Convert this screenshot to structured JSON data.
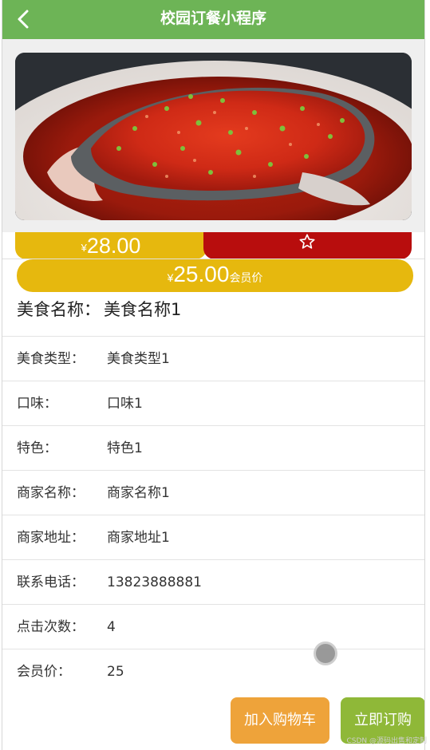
{
  "header": {
    "title": "校园订餐小程序"
  },
  "price": {
    "currency": "¥",
    "value": "28.00"
  },
  "vip": {
    "currency": "¥",
    "value": "25.00",
    "tag": "会员价"
  },
  "food": {
    "name_label": "美食名称：",
    "name_value": "美食名称1"
  },
  "details": [
    {
      "label": "美食类型：",
      "value": "美食类型1"
    },
    {
      "label": "口味：",
      "value": "口味1"
    },
    {
      "label": "特色：",
      "value": "特色1"
    },
    {
      "label": "商家名称：",
      "value": "商家名称1"
    },
    {
      "label": "商家地址：",
      "value": "商家地址1"
    },
    {
      "label": "联系电话：",
      "value": "13823888881"
    },
    {
      "label": "点击次数：",
      "value": "4"
    },
    {
      "label": "会员价：",
      "value": "25"
    }
  ],
  "actions": {
    "add_to_cart": "加入购物车",
    "buy_now": "立即订购"
  },
  "watermark": "CSDN @源码出售和定制",
  "icons": {
    "back": "chevron-left-icon",
    "favorite": "star-outline-icon"
  },
  "colors": {
    "header": "#6db456",
    "price": "#e6b80e",
    "favorite": "#b80d0d",
    "cart": "#eea33a",
    "buy": "#8fb838"
  }
}
